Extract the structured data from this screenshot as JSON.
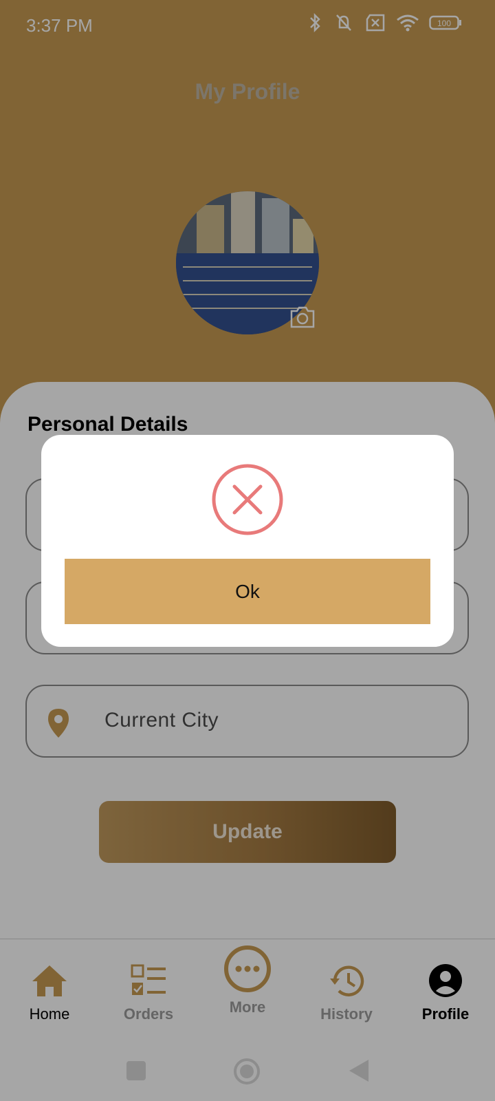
{
  "status_bar": {
    "time": "3:37 PM",
    "battery": "100"
  },
  "header": {
    "title": "My Profile"
  },
  "profile": {
    "section_title": "Personal Details",
    "city_placeholder": "Current City",
    "update_label": "Update"
  },
  "dialog": {
    "icon": "error-x-icon",
    "ok_label": "Ok"
  },
  "bottom_nav": {
    "items": [
      {
        "label": "Home",
        "icon": "home-icon"
      },
      {
        "label": "Orders",
        "icon": "orders-icon"
      },
      {
        "label": "More",
        "icon": "more-icon"
      },
      {
        "label": "History",
        "icon": "history-icon"
      },
      {
        "label": "Profile",
        "icon": "profile-icon"
      }
    ]
  },
  "colors": {
    "brand": "#c69a52",
    "dialog_button": "#d5a865",
    "error": "#e87a7a"
  }
}
